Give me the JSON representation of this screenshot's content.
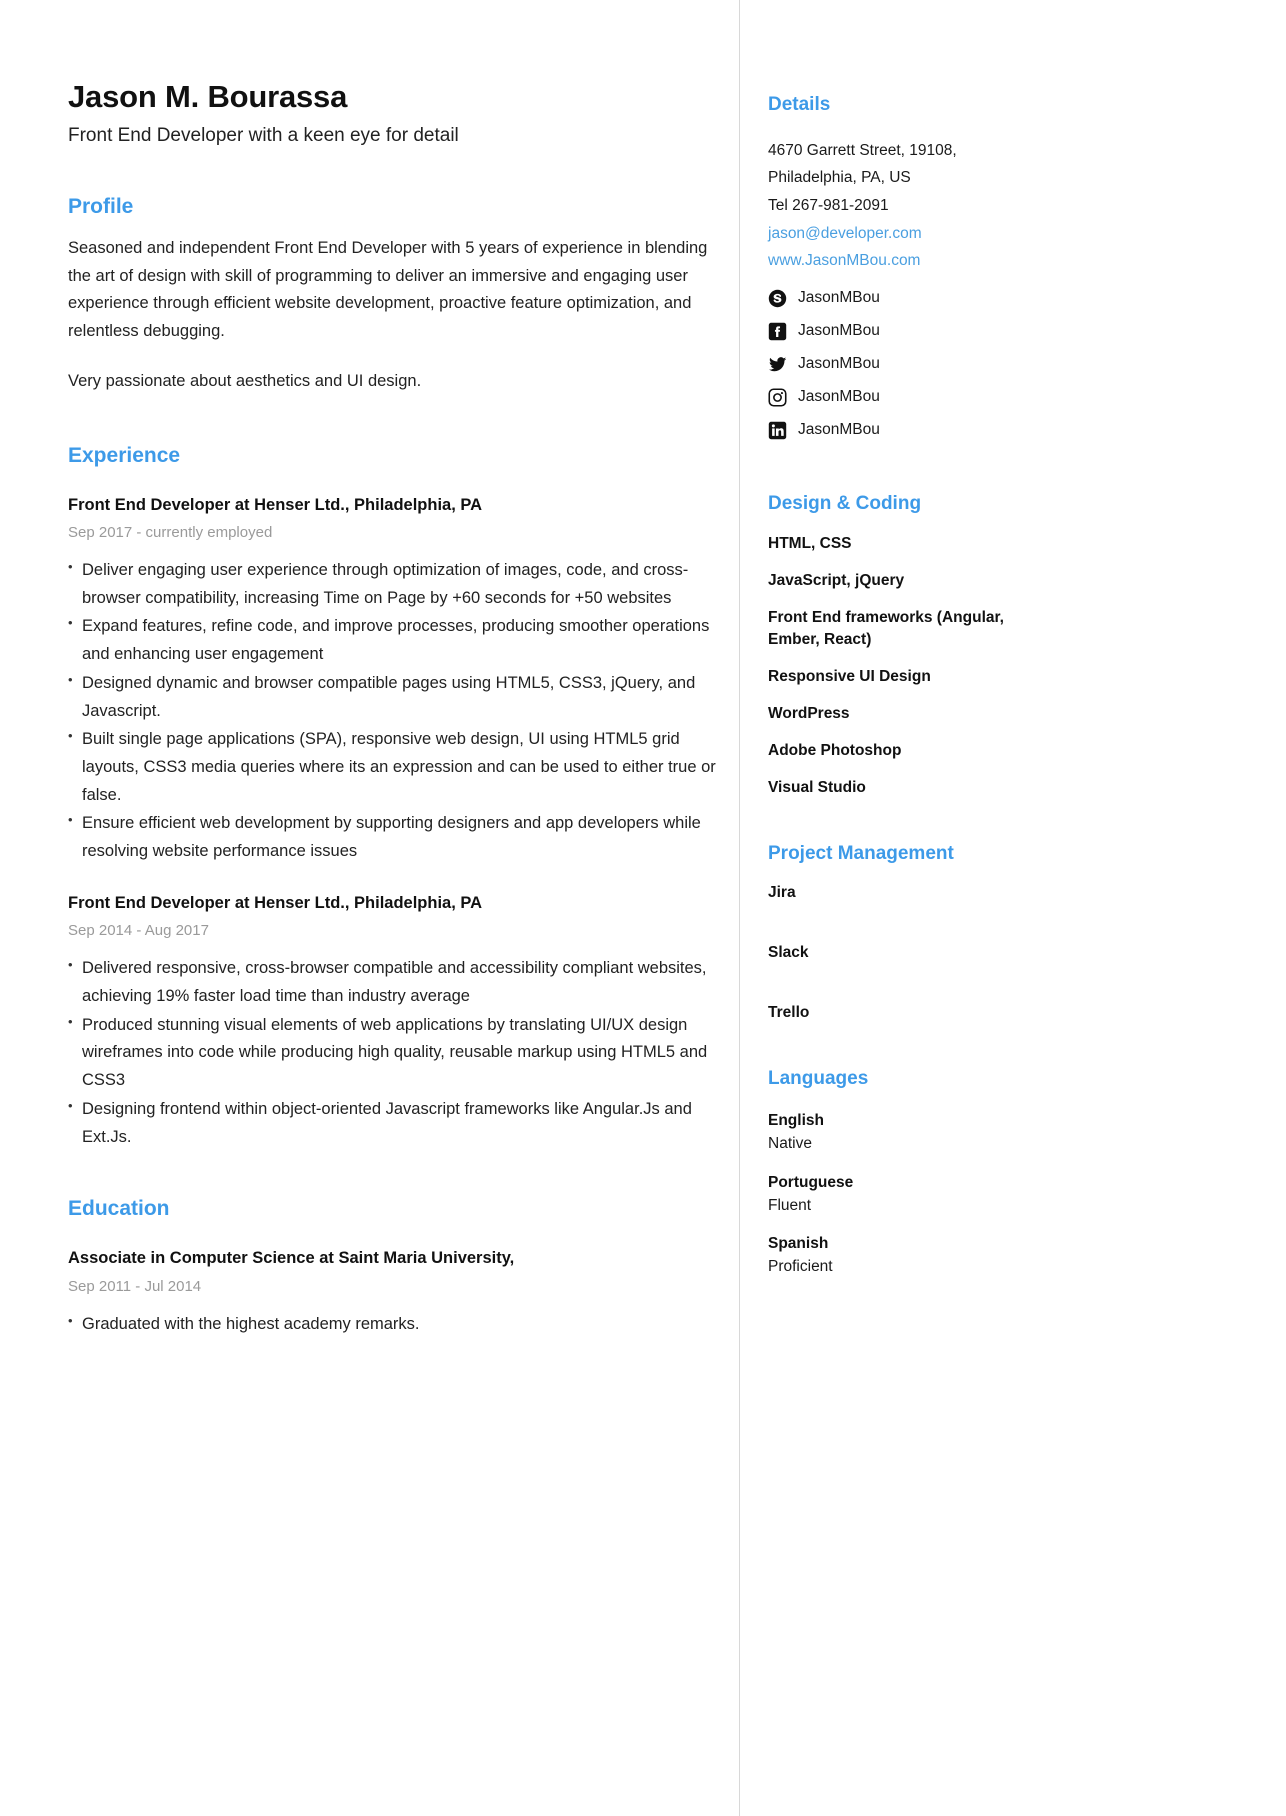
{
  "header": {
    "name": "Jason M. Bourassa",
    "headline": "Front End Developer with a keen eye for detail"
  },
  "profile": {
    "heading": "Profile",
    "paragraph1": "Seasoned and independent Front End Developer with 5 years of experience in blending the art of design with skill of programming to deliver an immersive and engaging user experience through efficient website development, proactive feature optimization, and relentless debugging.",
    "paragraph2": "Very passionate about aesthetics and UI design."
  },
  "experience": {
    "heading": "Experience",
    "entries": [
      {
        "title": "Front End Developer at Henser Ltd., Philadelphia, PA",
        "date": "Sep 2017 - currently employed",
        "bullets": [
          "Deliver engaging user experience through optimization of images, code, and cross-browser compatibility, increasing Time on Page by +60 seconds for +50 websites",
          "Expand features, refine code, and improve processes, producing smoother operations and enhancing user engagement",
          "Designed dynamic and browser compatible pages using HTML5, CSS3, jQuery, and Javascript.",
          "Built single page applications (SPA), responsive web design, UI using HTML5 grid layouts, CSS3 media queries where its an expression and can be used to either true or false.",
          "Ensure efficient web development by supporting designers and app developers while resolving website performance issues"
        ]
      },
      {
        "title": "Front End Developer at Henser Ltd., Philadelphia, PA",
        "date": "Sep 2014 - Aug 2017",
        "bullets": [
          "Delivered responsive, cross-browser compatible and accessibility compliant websites, achieving 19% faster load time than industry average",
          "Produced stunning visual elements of web applications by translating UI/UX design wireframes into code while producing high quality, reusable markup using HTML5 and CSS3",
          "Designing frontend within object-oriented Javascript frameworks like Angular.Js and Ext.Js."
        ]
      }
    ]
  },
  "education": {
    "heading": "Education",
    "entries": [
      {
        "title": "Associate in Computer Science at Saint Maria University,",
        "date": "Sep 2011 - Jul 2014",
        "bullets": [
          "Graduated with the highest academy remarks."
        ]
      }
    ]
  },
  "details": {
    "heading": "Details",
    "address_lines": [
      "4670 Garrett Street, 19108,",
      "Philadelphia, PA, US",
      "Tel 267-981-2091"
    ],
    "email": "jason@developer.com",
    "website": "www.JasonMBou.com",
    "socials": [
      {
        "icon": "skype-icon",
        "handle": "JasonMBou"
      },
      {
        "icon": "facebook-icon",
        "handle": "JasonMBou"
      },
      {
        "icon": "twitter-icon",
        "handle": "JasonMBou"
      },
      {
        "icon": "instagram-icon",
        "handle": "JasonMBou"
      },
      {
        "icon": "linkedin-icon",
        "handle": "JasonMBou"
      }
    ]
  },
  "design_coding": {
    "heading": "Design & Coding",
    "items": [
      "HTML, CSS",
      "JavaScript, jQuery",
      "Front End frameworks (Angular, Ember, React)",
      "Responsive UI Design",
      "WordPress",
      "Adobe Photoshop",
      "Visual Studio"
    ]
  },
  "project_management": {
    "heading": "Project Management",
    "items": [
      "Jira",
      "Slack",
      "Trello"
    ]
  },
  "languages": {
    "heading": "Languages",
    "items": [
      {
        "name": "English",
        "level": "Native"
      },
      {
        "name": "Portuguese",
        "level": "Fluent"
      },
      {
        "name": "Spanish",
        "level": "Proficient"
      }
    ]
  },
  "colors": {
    "accent": "#3d9ae8",
    "link": "#4a9fe0",
    "muted": "#9a9a9a",
    "text": "#222222"
  }
}
